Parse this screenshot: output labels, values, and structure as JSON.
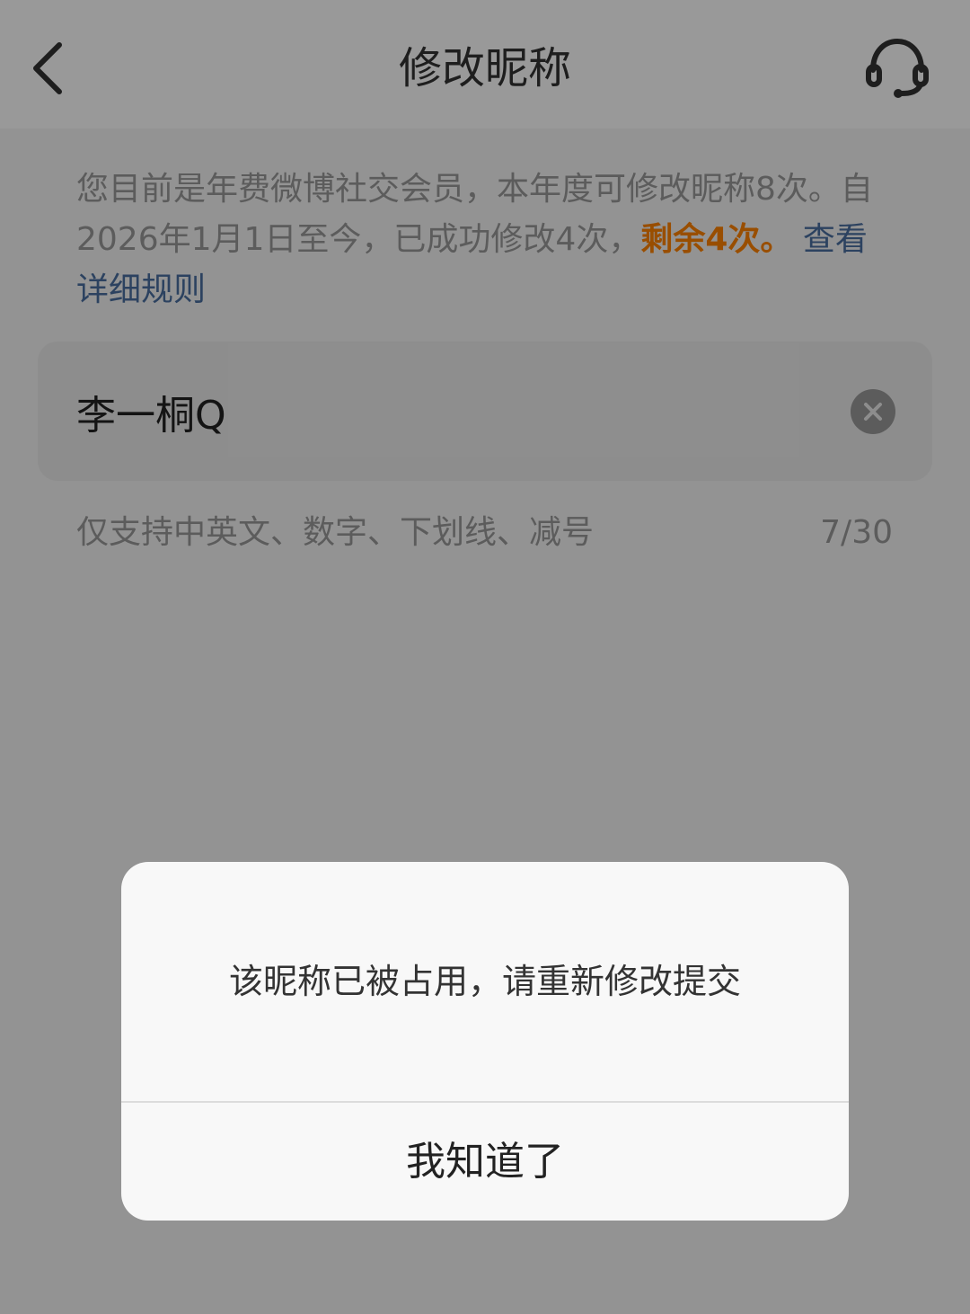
{
  "header": {
    "title": "修改昵称",
    "back_icon": "chevron-left-icon",
    "support_icon": "headset-icon"
  },
  "notice": {
    "text_before": "您目前是年费微博社交会员，本年度可修改昵称8次。自2026年1月1日至今，已成功修改4次，",
    "remaining": "剩余4次。",
    "rules_link": "查看详细规则"
  },
  "nickname_input": {
    "value": "李一桐Q",
    "clear_icon": "clear-circle-icon"
  },
  "hint": {
    "text": "仅支持中英文、数字、下划线、减号",
    "counter": "7/30"
  },
  "dialog": {
    "message": "该昵称已被占用，请重新修改提交",
    "button": "我知道了"
  },
  "colors": {
    "highlight": "#ff8200",
    "link": "#4a6fa0",
    "overlay": "rgba(0,0,0,0.4)"
  }
}
